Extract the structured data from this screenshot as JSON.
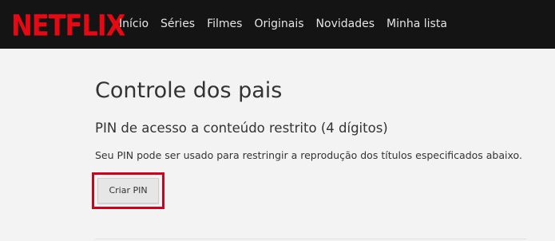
{
  "brand": {
    "logo_text": "NETFLIX",
    "logo_color": "#e50914"
  },
  "nav": {
    "items": [
      "Início",
      "Séries",
      "Filmes",
      "Originais",
      "Novidades",
      "Minha lista"
    ]
  },
  "page": {
    "title": "Controle dos pais",
    "section_title": "PIN de acesso a conteúdo restrito (4 dígitos)",
    "description": "Seu PIN pode ser usado para restringir a reprodução dos títulos especificados abaixo.",
    "create_pin_label": "Criar PIN",
    "highlight_color": "#d0021b"
  }
}
